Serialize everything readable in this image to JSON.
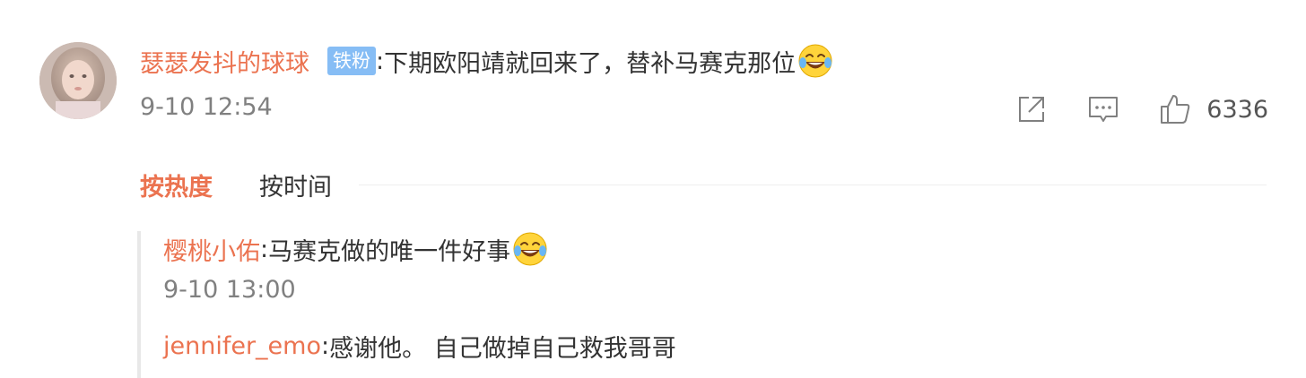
{
  "comment": {
    "username": "瑟瑟发抖的球球",
    "badge": "铁粉",
    "colon": ":",
    "text": "下期欧阳靖就回来了，替补马赛克那位",
    "emoji": "laugh-cry-emoji",
    "timestamp": "9-10 12:54",
    "like_count": "6336"
  },
  "sort": {
    "by_hot": "按热度",
    "by_time": "按时间"
  },
  "replies": [
    {
      "username": "樱桃小佑",
      "colon": ":",
      "text": "马赛克做的唯一件好事",
      "emoji": "laugh-cry-emoji",
      "timestamp": "9-10 13:00"
    },
    {
      "username": "jennifer_emo",
      "colon": ":",
      "text": "感谢他。 自己做掉自己救我哥哥"
    }
  ],
  "colors": {
    "username": "#eb7350",
    "badge_bg": "#86bdf5",
    "muted": "#808080"
  },
  "icons": [
    "share-icon",
    "comment-icon",
    "like-icon"
  ]
}
